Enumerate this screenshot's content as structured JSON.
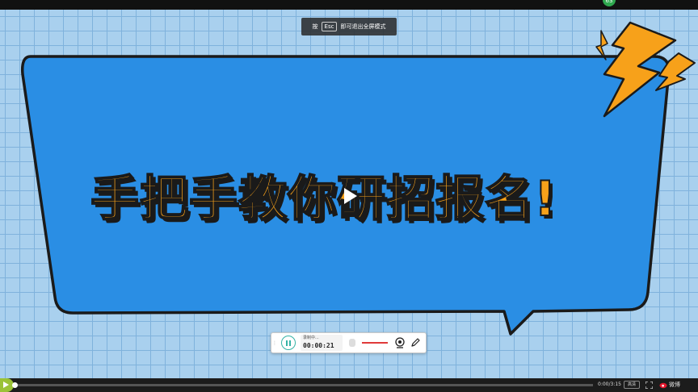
{
  "window": {
    "notification_badge": "63"
  },
  "overlay": {
    "esc_prefix": "按",
    "esc_key": "Esc",
    "esc_suffix": "即可退出全屏模式"
  },
  "slide": {
    "headline": "手把手教你研招报名!",
    "colors": {
      "background": "#a9d0ee",
      "bubble": "#2a8ee4",
      "text": "#f7a11a",
      "bolt": "#f7a11a",
      "outline": "#1a1a1a"
    }
  },
  "recorder": {
    "status": "录制中...",
    "elapsed": "00:00:21"
  },
  "player": {
    "current_time": "0:00",
    "duration": "3:15",
    "time_display": "0:00/3:15",
    "progress": 0.0,
    "quality_label": "高清",
    "share_label": "微博",
    "accent_color": "#8ab93a"
  }
}
